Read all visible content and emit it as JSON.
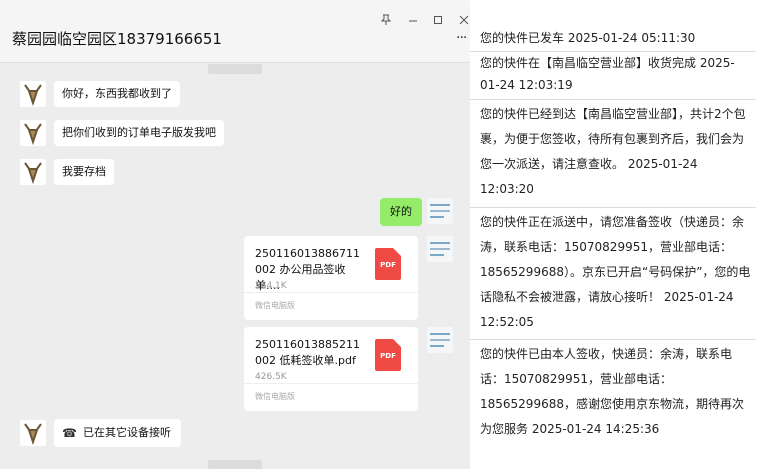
{
  "chat": {
    "title": "蔡园园临空园区18379166651",
    "window_controls": {
      "pin": "pin-icon",
      "minimize": "minimize-icon",
      "maximize": "maximize-icon",
      "close": "close-icon"
    },
    "messages": [
      {
        "side": "left",
        "type": "text",
        "text": "你好，东西我都收到了"
      },
      {
        "side": "left",
        "type": "text",
        "text": "把你们收到的订单电子版发我吧"
      },
      {
        "side": "left",
        "type": "text",
        "text": "我要存档"
      },
      {
        "side": "right",
        "type": "text",
        "text": "好的"
      }
    ],
    "files": [
      {
        "name": "250116013886711002 办公用品签收单....",
        "size": "384.1K",
        "source": "微信电脑版",
        "icon_label": "PDF"
      },
      {
        "name": "250116013885211002 低耗签收单.pdf",
        "size": "426.5K",
        "source": "微信电脑版",
        "icon_label": "PDF"
      }
    ],
    "call": {
      "icon": "phone-hangup-icon",
      "text": "已在其它设备接听"
    }
  },
  "tracking": [
    {
      "text": "您的快件已发车 2025-01-24 05:11:30"
    },
    {
      "text": "您的快件在【南昌临空营业部】收货完成 2025-01-24 12:03:19"
    },
    {
      "text": "您的快件已经到达【南昌临空营业部】，共计2个包裹，为便于您签收，待所有包裹到齐后，我们会为您一次派送，请注意查收。 2025-01-24 12:03:20"
    },
    {
      "text": "您的快件正在派送中，请您准备签收（快递员：余涛，联系电话：15070829951，营业部电话：18565299688）。京东已开启“号码保护”，您的电话隐私不会被泄露，请放心接听！ 2025-01-24 12:52:05"
    },
    {
      "text": "您的快件已由本人签收，快递员：余涛，联系电话：15070829951，营业部电话：18565299688，感谢您使用京东物流，期待再次为您服务 2025-01-24 14:25:36"
    }
  ]
}
